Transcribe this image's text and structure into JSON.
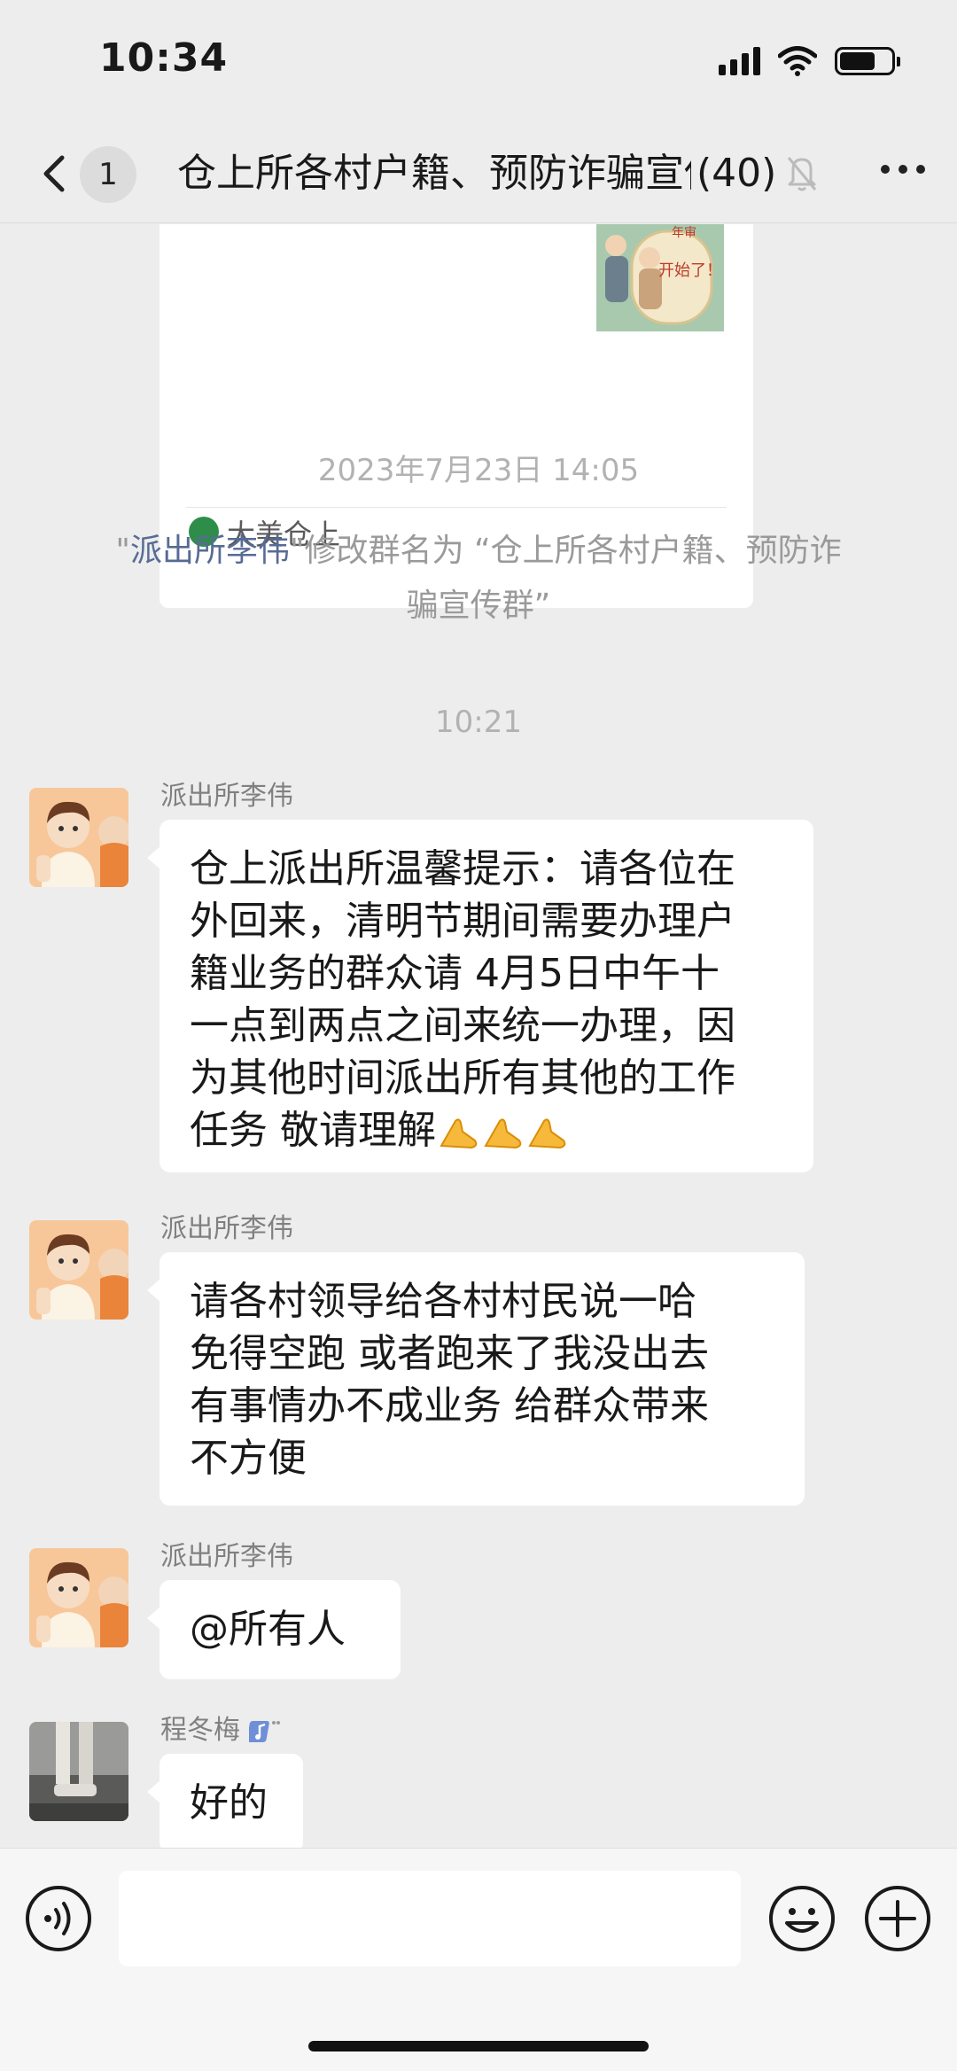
{
  "status_bar": {
    "time": "10:34"
  },
  "nav": {
    "unread_count": "1",
    "title": "仓上所各村户籍、预防诈骗宣传群",
    "member_count": "(40)"
  },
  "card": {
    "source": "大美仓上",
    "thumb_text_1": "年审",
    "thumb_text_2": "开始了！"
  },
  "timestamps": {
    "first": "2023年7月23日 14:05",
    "second": "10:21"
  },
  "system_message": {
    "quote_open": "\"",
    "name": "派出所李伟",
    "line1_rest": "\"修改群名为 “仓上所各村户籍、预防诈",
    "line2": "骗宣传群”"
  },
  "messages": [
    {
      "sender": "派出所李伟",
      "lines": [
        "仓上派出所温馨提示：请各位在",
        "外回来，清明节期间需要办理户",
        "籍业务的群众请 4月5日中午十",
        "一点到两点之间来统一办理，因",
        "为其他时间派出所有其他的工作"
      ],
      "last_line": "任务  敬请理解"
    },
    {
      "sender": "派出所李伟",
      "lines": [
        "请各村领导给各村村民说一哈",
        "免得空跑  或者跑来了我没出去",
        "有事情办不成业务  给群众带来",
        "不方便"
      ]
    },
    {
      "sender": "派出所李伟",
      "lines": [
        "@所有人"
      ]
    },
    {
      "sender": "程冬梅",
      "lines": [
        "好的"
      ]
    }
  ],
  "colors": {
    "background": "#ededed",
    "bubble": "#ffffff",
    "link_name": "#576b95",
    "meta_text": "#b2b2b2"
  },
  "icons": [
    "back-icon",
    "mute-icon",
    "more-icon",
    "voice-icon",
    "emoji-icon",
    "plus-icon"
  ]
}
